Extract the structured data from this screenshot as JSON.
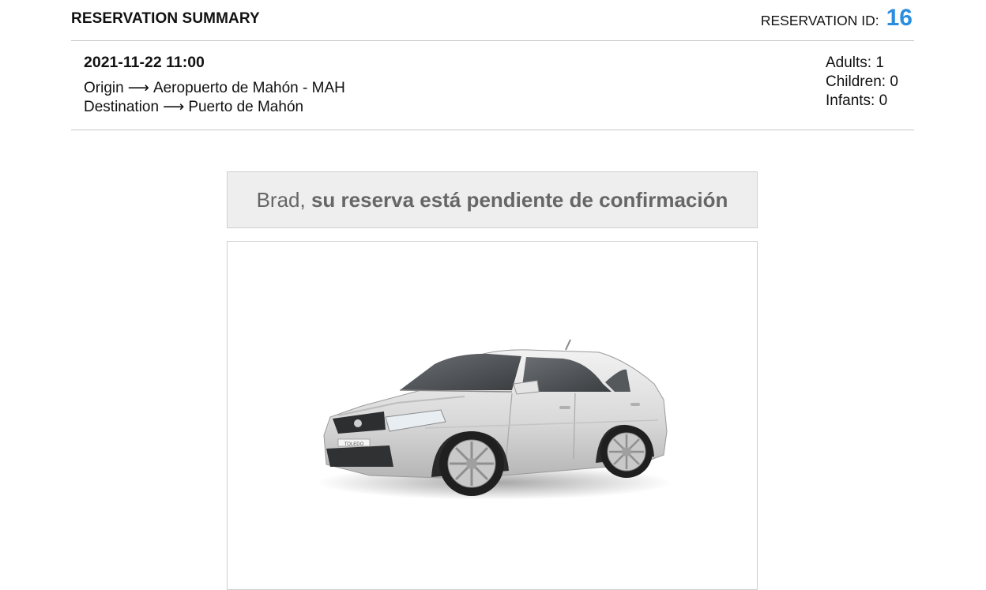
{
  "header": {
    "title": "RESERVATION SUMMARY",
    "reservation_id_label": "RESERVATION ID:",
    "reservation_id_value": "16"
  },
  "trip": {
    "datetime": "2021-11-22 11:00",
    "origin_label": "Origin",
    "origin_value": "Aeropuerto de Mahón - MAH",
    "destination_label": "Destination",
    "destination_value": "Puerto de Mahón",
    "arrow": "⟶"
  },
  "passengers": {
    "adults": "Adults: 1",
    "children": "Children: 0",
    "infants": "Infants: 0"
  },
  "status": {
    "name": "Brad",
    "separator": ", ",
    "message": "su reserva está pendiente de confirmación"
  },
  "vehicle": {
    "plate_text": "TOLEDO",
    "icon": "car-image"
  },
  "colors": {
    "accent": "#2a8de0",
    "status_bg": "#eeeeee",
    "status_text": "#666666"
  }
}
